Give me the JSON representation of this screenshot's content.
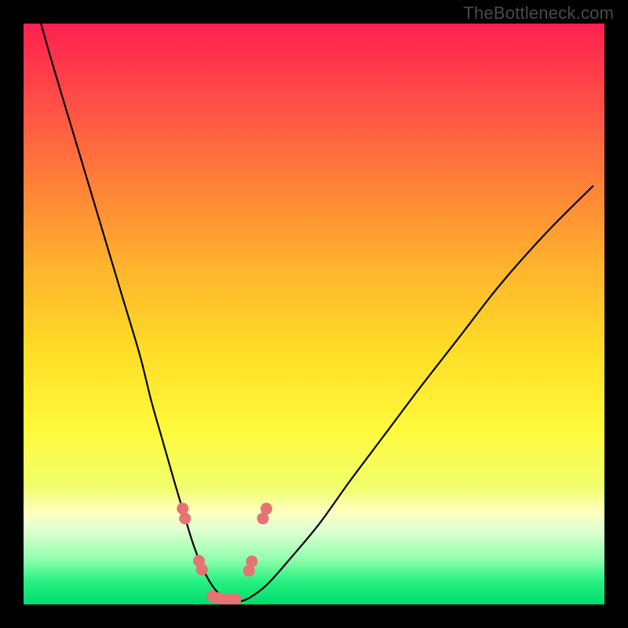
{
  "watermark": "TheBottleneck.com",
  "chart_data": {
    "type": "line",
    "title": "",
    "xlabel": "",
    "ylabel": "",
    "xlim": [
      0,
      100
    ],
    "ylim": [
      0,
      100
    ],
    "series": [
      {
        "name": "bottleneck-curve",
        "x": [
          3,
          5,
          8,
          11,
          14,
          17,
          20,
          22,
          24,
          26,
          27.5,
          29,
          30.5,
          32,
          33.5,
          35,
          37,
          39,
          42,
          46,
          51,
          56,
          62,
          68,
          75,
          82,
          90,
          98
        ],
        "y": [
          100,
          93,
          83,
          73,
          63,
          53,
          43,
          35,
          28,
          21,
          16,
          11,
          7,
          4,
          2,
          0.8,
          0.5,
          1.2,
          3.5,
          8,
          14,
          21,
          29,
          37,
          46,
          55,
          64,
          72
        ],
        "color": "#000000"
      }
    ],
    "markers": {
      "name": "highlight-dots",
      "color": "#e57373",
      "points": [
        {
          "x": 27.4,
          "y": 16.5
        },
        {
          "x": 27.8,
          "y": 14.8
        },
        {
          "x": 30.2,
          "y": 7.5
        },
        {
          "x": 30.7,
          "y": 6.0
        },
        {
          "x": 32.5,
          "y": 1.4
        },
        {
          "x": 33.5,
          "y": 1.1
        },
        {
          "x": 34.5,
          "y": 0.9
        },
        {
          "x": 35.5,
          "y": 0.8
        },
        {
          "x": 36.5,
          "y": 0.9
        },
        {
          "x": 38.8,
          "y": 5.8
        },
        {
          "x": 39.3,
          "y": 7.4
        },
        {
          "x": 41.2,
          "y": 14.8
        },
        {
          "x": 41.8,
          "y": 16.5
        }
      ]
    }
  }
}
